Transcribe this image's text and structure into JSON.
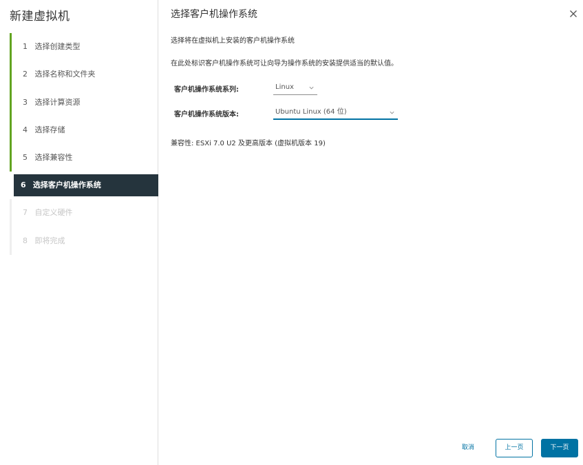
{
  "sidebar": {
    "title": "新建虚拟机",
    "steps": [
      {
        "num": "1",
        "label": "选择创建类型"
      },
      {
        "num": "2",
        "label": "选择名称和文件夹"
      },
      {
        "num": "3",
        "label": "选择计算资源"
      },
      {
        "num": "4",
        "label": "选择存储"
      },
      {
        "num": "5",
        "label": "选择兼容性"
      },
      {
        "num": "6",
        "label": "选择客户机操作系统"
      },
      {
        "num": "7",
        "label": "自定义硬件"
      },
      {
        "num": "8",
        "label": "即将完成"
      }
    ],
    "active_step": 6
  },
  "main": {
    "title": "选择客户机操作系统",
    "description": "选择将在虚拟机上安装的客户机操作系统",
    "hint": "在此处标识客户机操作系统可让向导为操作系统的安装提供适当的默认值。",
    "os_family_label": "客户机操作系统系列:",
    "os_family_value": "Linux",
    "os_version_label": "客户机操作系统版本:",
    "os_version_value": "Ubuntu Linux (64 位)",
    "compatibility": "兼容性: ESXi 7.0 U2 及更高版本 (虚拟机版本 19)"
  },
  "footer": {
    "cancel": "取消",
    "back": "上一页",
    "next": "下一页"
  },
  "icons": {
    "close": "close-icon",
    "chevron": "chevron-down-icon"
  },
  "colors": {
    "completed_step_bar": "#62a420",
    "active_step_bg": "#25343d",
    "primary": "#0072a3"
  }
}
